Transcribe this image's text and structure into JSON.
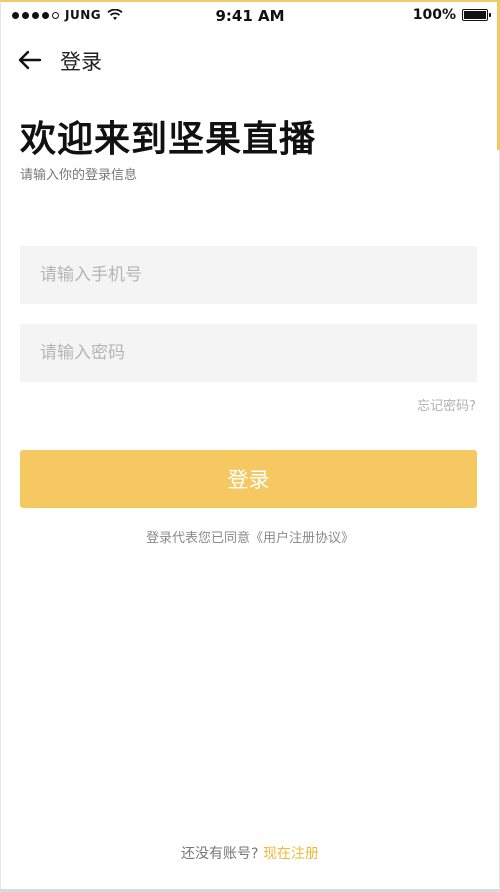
{
  "status_bar": {
    "carrier": "JUNG",
    "time": "9:41 AM",
    "battery": "100%"
  },
  "nav": {
    "title": "登录",
    "back_icon": "arrow-left-icon"
  },
  "header": {
    "title": "欢迎来到坚果直播",
    "subtitle": "请输入你的登录信息"
  },
  "form": {
    "phone_placeholder": "请输入手机号",
    "password_placeholder": "请输入密码",
    "forgot_label": "忘记密码?",
    "login_label": "登录",
    "agreement_text": "登录代表您已同意《用户注册协议》"
  },
  "footer": {
    "prompt": "还没有账号?",
    "register_label": "现在注册"
  },
  "colors": {
    "accent": "#f5c862",
    "link": "#f0b83a"
  }
}
